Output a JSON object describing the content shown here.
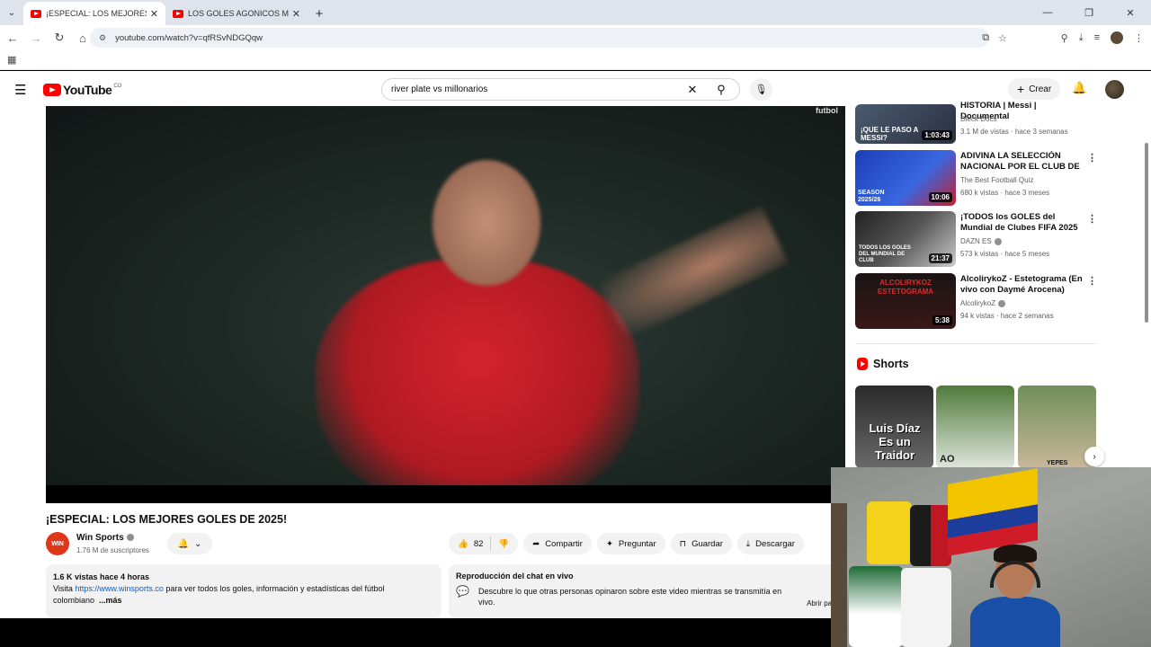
{
  "browser": {
    "tabs": [
      {
        "label": "¡ESPECIAL: LOS MEJORES GOLE",
        "active": true
      },
      {
        "label": "LOS GOLES AGONICOS MÁS E",
        "active": false
      }
    ],
    "url": "youtube.com/watch?v=qfRSvNDGQqw"
  },
  "header": {
    "logo_text": "YouTube",
    "logo_sup": "CO",
    "search_value": "river plate vs millonarios",
    "create_label": "Crear"
  },
  "video": {
    "watermark": "futbol",
    "title": "¡ESPECIAL: LOS MEJORES GOLES DE 2025!",
    "channel_logo": "WIN",
    "channel_name": "Win Sports",
    "subscribers": "1.76 M de suscriptores",
    "likes": "82",
    "share_label": "Compartir",
    "ask_label": "Preguntar",
    "save_label": "Guardar",
    "download_label": "Descargar"
  },
  "description": {
    "meta": "1.6 K vistas  hace 4 horas",
    "prefix": "Visita ",
    "link": "https://www.winsports.co",
    "suffix": " para ver todos los goles, información y estadísticas del fútbol",
    "line2": "colombiano",
    "more": "...más"
  },
  "chat": {
    "title": "Reproducción del chat en vivo",
    "text": "Descubre lo que otras personas opinaron sobre este video mientras se transmitía en vivo.",
    "open": "Abrir pane"
  },
  "sidebar": {
    "items": [
      {
        "title": "HISTORIA | Messi | Documental",
        "channel": "Dieck Docs",
        "meta": "3.1 M de vistas · hace 3 semanas",
        "duration": "1:03:43",
        "verified": false
      },
      {
        "title": "ADIVINA LA SELECCIÓN NACIONAL POR EL CLUB DE ...",
        "channel": "The Best Football Quiz",
        "meta": "680 k vistas · hace 3 meses",
        "duration": "10:06",
        "verified": false
      },
      {
        "title": "¡TODOS los GOLES del Mundial de Clubes FIFA 2025 en 20 ...",
        "channel": "DAZN ES",
        "meta": "573 k vistas · hace 5 meses",
        "duration": "21:37",
        "verified": true
      },
      {
        "title": "AlcolirykoZ - Estetograma (En vivo con Daymé Arocena)",
        "channel": "AlcolirykoZ",
        "meta": "94 k vistas · hace 2 semanas",
        "duration": "5:38",
        "verified": true
      }
    ],
    "thumb_captions": [
      "¡QUE LE PASO A MESSI?",
      "SEASON 2025/26",
      "TODOS LOS GOLES DEL MUNDIAL DE CLUB",
      "ALCOLIRYKOZ ESTETOGRAMA"
    ],
    "shorts_label": "Shorts",
    "shorts_captions": [
      "Luis Díaz Es un Traidor",
      "AO",
      "YEPES"
    ]
  },
  "colors": {
    "youtube_red": "#ff0000",
    "link_blue": "#065fd4",
    "jersey_red": "#d4232c"
  }
}
